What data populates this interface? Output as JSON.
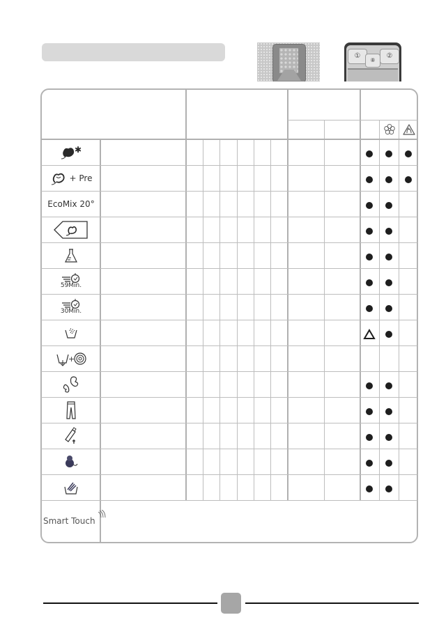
{
  "header": {
    "title_bar_text": "",
    "photos": [
      {
        "name": "detergent-drawer-photo"
      },
      {
        "name": "control-panel-photo",
        "buttons": [
          "①",
          "②"
        ],
        "center_button": "⑧"
      }
    ]
  },
  "table": {
    "header_icons": [
      "flower-fabric-softener-icon",
      "flame-icon"
    ],
    "rows": [
      {
        "icon": "cotton-plus-icon",
        "text": "",
        "marks": [
          "dot",
          "dot",
          "dot"
        ]
      },
      {
        "icon": "cotton-icon",
        "text": "+ Pre",
        "marks": [
          "dot",
          "dot",
          "dot"
        ]
      },
      {
        "icon": "",
        "text": "EcoMix 20°",
        "marks": [
          "dot",
          "dot",
          ""
        ]
      },
      {
        "icon": "cotton-tag-icon",
        "text": "",
        "marks": [
          "dot",
          "dot",
          ""
        ]
      },
      {
        "icon": "flask-icon",
        "text": "",
        "marks": [
          "dot",
          "dot",
          ""
        ]
      },
      {
        "icon": "rapid-timer-icon",
        "text": "59Min.",
        "marks": [
          "dot",
          "dot",
          ""
        ]
      },
      {
        "icon": "rapid-timer-icon",
        "text": "30Min.",
        "marks": [
          "dot",
          "dot",
          ""
        ]
      },
      {
        "icon": "rinse-icon",
        "text": "",
        "marks": [
          "triangle",
          "dot",
          ""
        ]
      },
      {
        "icon": "drain-spin-icon",
        "text": "",
        "marks": [
          "",
          "",
          ""
        ]
      },
      {
        "icon": "butterfly-delicates-icon",
        "text": "",
        "marks": [
          "dot",
          "dot",
          ""
        ]
      },
      {
        "icon": "jeans-icon",
        "text": "",
        "marks": [
          "dot",
          "dot",
          ""
        ]
      },
      {
        "icon": "baby-bottle-icon",
        "text": "",
        "marks": [
          "dot",
          "dot",
          ""
        ]
      },
      {
        "icon": "wool-yarn-icon",
        "text": "",
        "marks": [
          "dot",
          "dot",
          ""
        ]
      },
      {
        "icon": "hand-wash-icon",
        "text": "",
        "marks": [
          "dot",
          "dot",
          ""
        ]
      }
    ],
    "smart_touch_label": "Smart Touch"
  },
  "footer": {
    "page_number": ""
  }
}
